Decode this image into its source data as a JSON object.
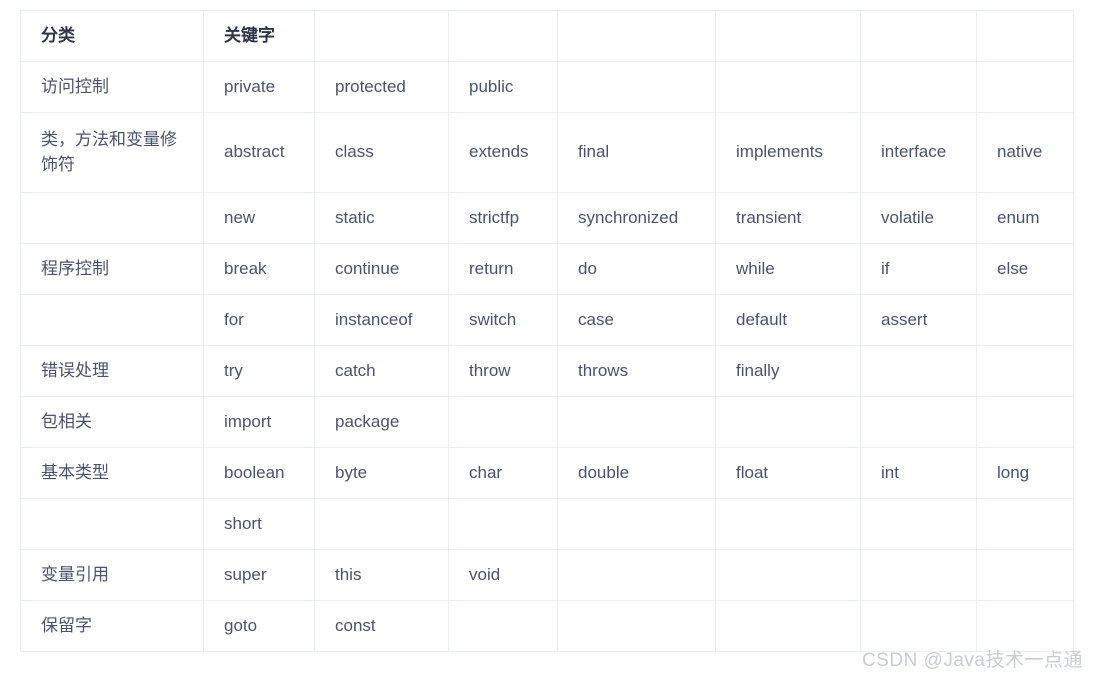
{
  "table": {
    "headers": [
      "分类",
      "关键字",
      "",
      "",
      "",
      "",
      "",
      ""
    ],
    "rows": [
      {
        "tall": false,
        "cells": [
          "访问控制",
          "private",
          "protected",
          "public",
          "",
          "",
          "",
          ""
        ]
      },
      {
        "tall": true,
        "cells": [
          "类，方法和变量修饰符",
          "abstract",
          "class",
          "extends",
          "final",
          "implements",
          "interface",
          "native"
        ]
      },
      {
        "tall": false,
        "cells": [
          "",
          "new",
          "static",
          "strictfp",
          "synchronized",
          "transient",
          "volatile",
          "enum"
        ]
      },
      {
        "tall": false,
        "cells": [
          "程序控制",
          "break",
          "continue",
          "return",
          "do",
          "while",
          "if",
          "else"
        ]
      },
      {
        "tall": false,
        "cells": [
          "",
          "for",
          "instanceof",
          "switch",
          "case",
          "default",
          "assert",
          ""
        ]
      },
      {
        "tall": false,
        "cells": [
          "错误处理",
          "try",
          "catch",
          "throw",
          "throws",
          "finally",
          "",
          ""
        ]
      },
      {
        "tall": false,
        "cells": [
          "包相关",
          "import",
          "package",
          "",
          "",
          "",
          "",
          ""
        ]
      },
      {
        "tall": false,
        "cells": [
          "基本类型",
          "boolean",
          "byte",
          "char",
          "double",
          "float",
          "int",
          "long"
        ]
      },
      {
        "tall": false,
        "cells": [
          "",
          "short",
          "",
          "",
          "",
          "",
          "",
          ""
        ]
      },
      {
        "tall": false,
        "cells": [
          "变量引用",
          "super",
          "this",
          "void",
          "",
          "",
          "",
          ""
        ]
      },
      {
        "tall": false,
        "cells": [
          "保留字",
          "goto",
          "const",
          "",
          "",
          "",
          "",
          ""
        ]
      }
    ]
  },
  "watermark": {
    "text": "CSDN @Java技术一点通"
  },
  "colors": {
    "header_text": "#2d3547",
    "cell_text": "#49536b",
    "border": "#ebeef3",
    "watermark_text": "#c9ccd2",
    "background": "#ffffff"
  }
}
